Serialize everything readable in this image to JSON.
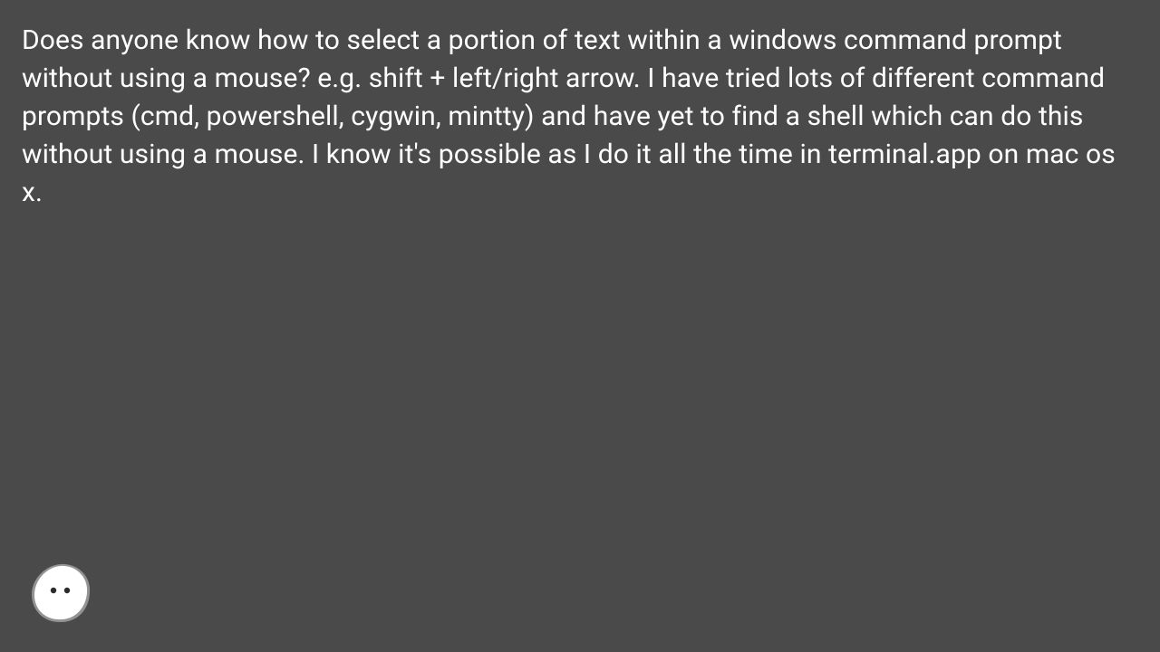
{
  "post": {
    "body": "Does anyone know how to select a portion of text within a windows command prompt without using a mouse? e.g. shift + left/right arrow. I have tried lots of different command prompts (cmd, powershell, cygwin, mintty) and have yet to find a shell which can do this without using a mouse. I know it's possible as I do it all the time in terminal.app on mac os x."
  },
  "colors": {
    "background": "#4a4a4a",
    "text": "#ffffff"
  }
}
